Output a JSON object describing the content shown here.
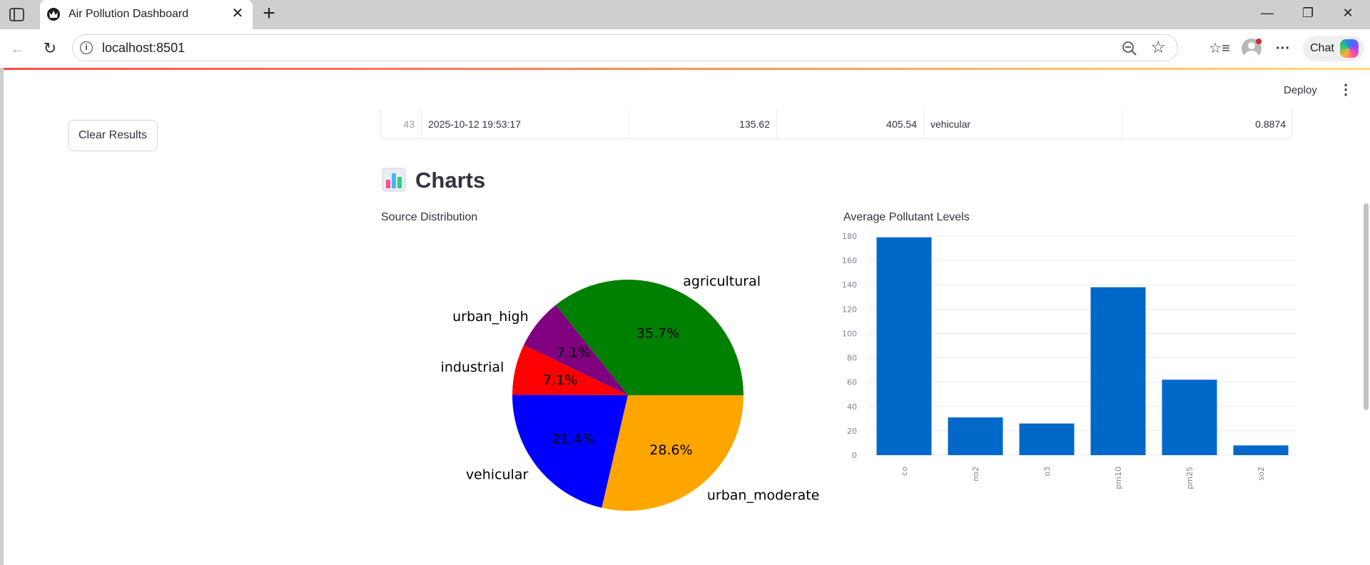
{
  "browser": {
    "tab_title": "Air Pollution Dashboard",
    "url": "localhost:8501",
    "chat_label": "Chat",
    "icons": [
      "sidebar-toggle-icon",
      "app-favicon",
      "close-icon",
      "new-tab-icon",
      "minimize-icon",
      "restore-icon",
      "window-close-icon",
      "back-icon",
      "reload-icon",
      "site-info-icon",
      "zoom-out-icon",
      "favorite-star-icon",
      "favorites-icon",
      "profile-icon",
      "more-icon",
      "copilot-icon"
    ]
  },
  "app": {
    "deploy_label": "Deploy",
    "clear_button": "Clear Results"
  },
  "table": {
    "last_row": {
      "index": "43",
      "timestamp": "2025-10-12 19:53:17",
      "value_a": "135.62",
      "value_b": "405.54",
      "source": "vehicular",
      "score": "0.8874"
    }
  },
  "section": {
    "emoji": "bar-chart-emoji",
    "title": "Charts"
  },
  "charts": {
    "pie_title": "Source Distribution",
    "bar_title": "Average Pollutant Levels"
  },
  "chart_data": [
    {
      "type": "pie",
      "title": "Source Distribution",
      "labels": [
        "agricultural",
        "urban_high",
        "industrial",
        "vehicular",
        "urban_moderate"
      ],
      "values": [
        35.7,
        7.1,
        7.1,
        21.4,
        28.6
      ],
      "pct_labels": [
        "35.7%",
        "7.1%",
        "7.1%",
        "21.4%",
        "28.6%"
      ],
      "colors": [
        "#008000",
        "#800080",
        "#ff0000",
        "#0000ff",
        "#ffa500"
      ]
    },
    {
      "type": "bar",
      "title": "Average Pollutant Levels",
      "categories": [
        "co",
        "no2",
        "o3",
        "pm10",
        "pm25",
        "so2"
      ],
      "values": [
        179,
        31,
        26,
        138,
        62,
        8
      ],
      "ylim": [
        0,
        180
      ],
      "yticks": [
        0,
        20,
        40,
        60,
        80,
        100,
        120,
        140,
        160,
        180
      ],
      "grid": true,
      "color": "#0068c9"
    }
  ]
}
